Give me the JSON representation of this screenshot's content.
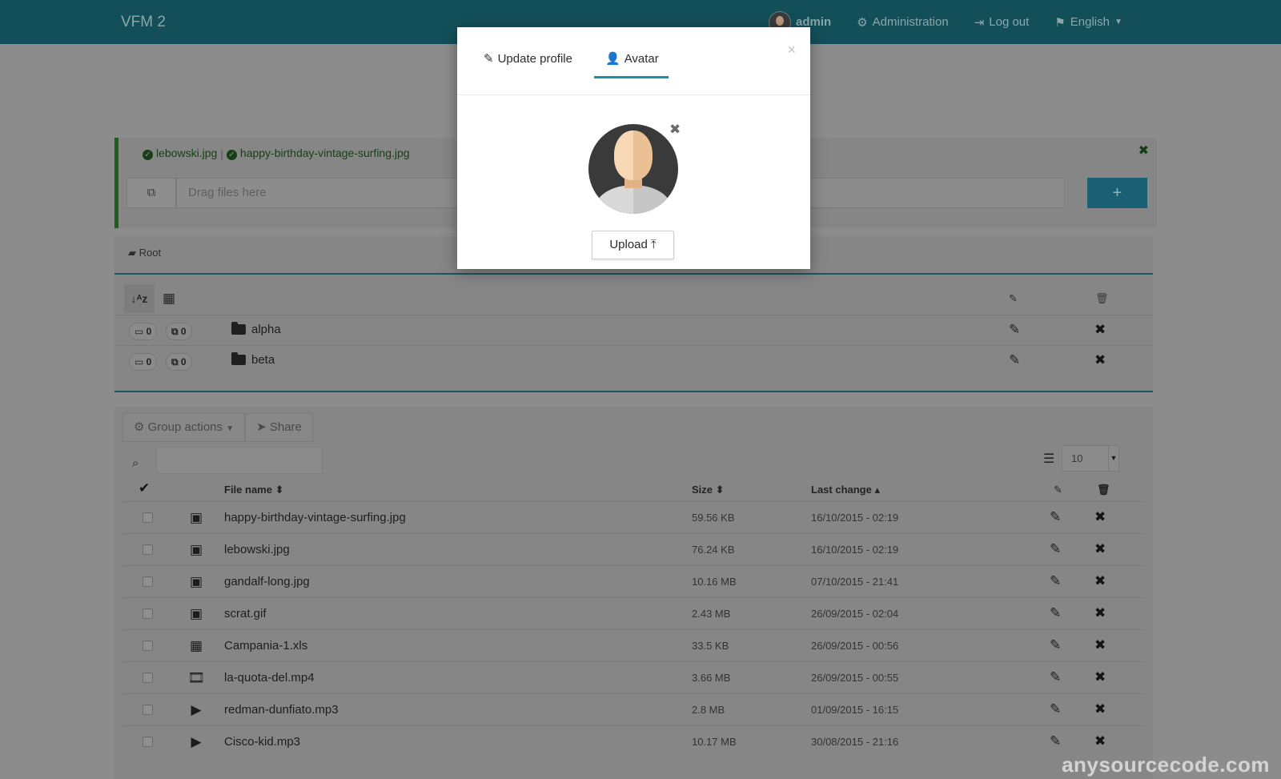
{
  "navbar": {
    "brand": "VFM 2",
    "user": "admin",
    "admin_label": "Administration",
    "logout_label": "Log out",
    "lang_label": "English"
  },
  "upload": {
    "done_files": [
      "lebowski.jpg",
      "happy-birthday-vintage-surfing.jpg"
    ],
    "drop_placeholder": "Drag files here",
    "add_label": "+"
  },
  "folders": {
    "breadcrumb": "Root",
    "items": [
      {
        "name": "alpha",
        "folders": "0",
        "files": "0"
      },
      {
        "name": "beta",
        "folders": "0",
        "files": "0"
      }
    ]
  },
  "files": {
    "group_actions": "Group actions",
    "share": "Share",
    "per_page": "10",
    "headers": {
      "name": "File name",
      "size": "Size",
      "date": "Last change"
    },
    "rows": [
      {
        "icon": "image-icon",
        "name": "happy-birthday-vintage-surfing.jpg",
        "size": "59.56 KB",
        "date": "16/10/2015 - 02:19"
      },
      {
        "icon": "image-icon",
        "name": "lebowski.jpg",
        "size": "76.24 KB",
        "date": "16/10/2015 - 02:19"
      },
      {
        "icon": "image-icon",
        "name": "gandalf-long.jpg",
        "size": "10.16 MB",
        "date": "07/10/2015 - 21:41"
      },
      {
        "icon": "image-icon",
        "name": "scrat.gif",
        "size": "2.43 MB",
        "date": "26/09/2015 - 02:04"
      },
      {
        "icon": "spreadsheet-icon",
        "name": "Campania-1.xls",
        "size": "33.5 KB",
        "date": "26/09/2015 - 00:56"
      },
      {
        "icon": "video-icon",
        "name": "la-quota-del.mp4",
        "size": "3.66 MB",
        "date": "26/09/2015 - 00:55"
      },
      {
        "icon": "audio-play-icon",
        "name": "redman-dunfiato.mp3",
        "size": "2.8 MB",
        "date": "01/09/2015 - 16:15"
      },
      {
        "icon": "audio-play-icon",
        "name": "Cisco-kid.mp3",
        "size": "10.17 MB",
        "date": "30/08/2015 - 21:16"
      }
    ]
  },
  "modal": {
    "tab_profile": "Update profile",
    "tab_avatar": "Avatar",
    "upload_label": "Upload"
  },
  "watermark": "anysourcecode.com"
}
